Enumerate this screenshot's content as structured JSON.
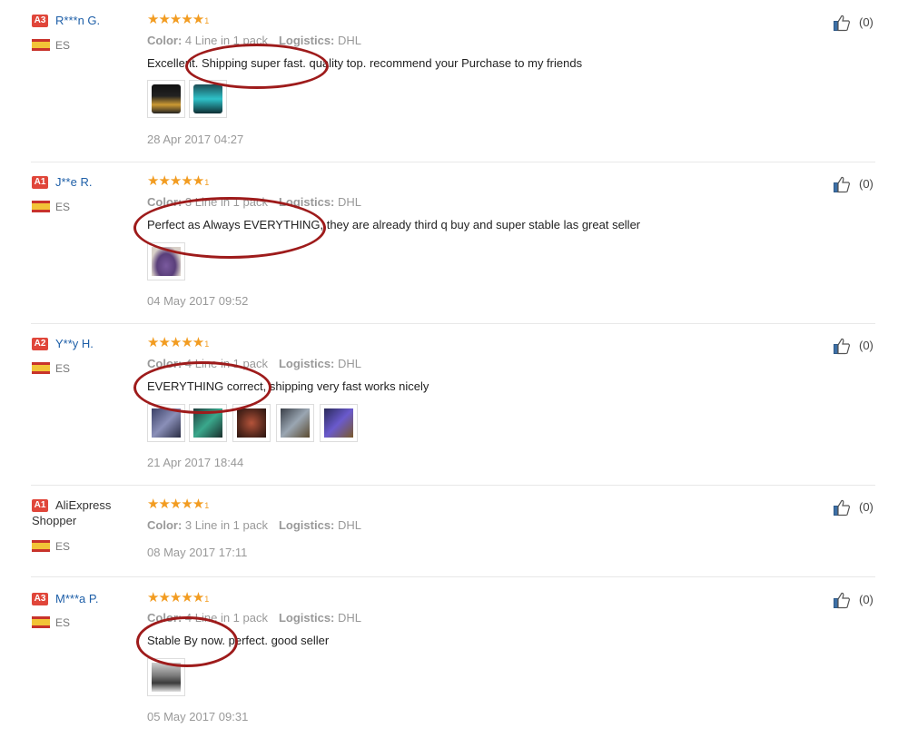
{
  "labels": {
    "color": "Color:",
    "logistics": "Logistics:"
  },
  "reviews": [
    {
      "badge": "A3",
      "name": "R***n G.",
      "country": "ES",
      "stars": "★★★★★",
      "star_count": "1",
      "color": "4 Line in 1 pack",
      "logistics": "DHL",
      "content": "Excellent. Shipping super fast. quality top. recommend your Purchase to my friends",
      "date": "28 Apr 2017 04:27",
      "likes": "(0)",
      "photos": [
        "phone-dark",
        "phone-teal"
      ]
    },
    {
      "badge": "A1",
      "name": "J**e R.",
      "country": "ES",
      "stars": "★★★★★",
      "star_count": "1",
      "color": "3 Line in 1 pack",
      "logistics": "DHL",
      "content": "Perfect as Always EVERYTHING, they are already third q buy and super stable las great seller",
      "date": "04 May 2017 09:52",
      "likes": "(0)",
      "photos": [
        "purple-cable"
      ]
    },
    {
      "badge": "A2",
      "name": "Y**y H.",
      "country": "ES",
      "stars": "★★★★★",
      "star_count": "1",
      "color": "4 Line in 1 pack",
      "logistics": "DHL",
      "content": "EVERYTHING correct, shipping very fast works nicely",
      "date": "21 Apr 2017 18:44",
      "likes": "(0)",
      "photos": [
        "screen-blue",
        "screen-green",
        "screen-red",
        "screen-gold",
        "screen-navy"
      ]
    },
    {
      "badge": "A1",
      "name": "AliExpress Shopper",
      "country": "ES",
      "stars": "★★★★★",
      "star_count": "1",
      "color": "3 Line in 1 pack",
      "logistics": "DHL",
      "content": "",
      "date": "08 May 2017 17:11",
      "likes": "(0)",
      "photos": []
    },
    {
      "badge": "A3",
      "name": "M***a P.",
      "country": "ES",
      "stars": "★★★★★",
      "star_count": "1",
      "color": "4 Line in 1 pack",
      "logistics": "DHL",
      "content": "Stable By now. perfect. good seller",
      "date": "05 May 2017 09:31",
      "likes": "(0)",
      "photos": [
        "room-grey"
      ]
    }
  ]
}
